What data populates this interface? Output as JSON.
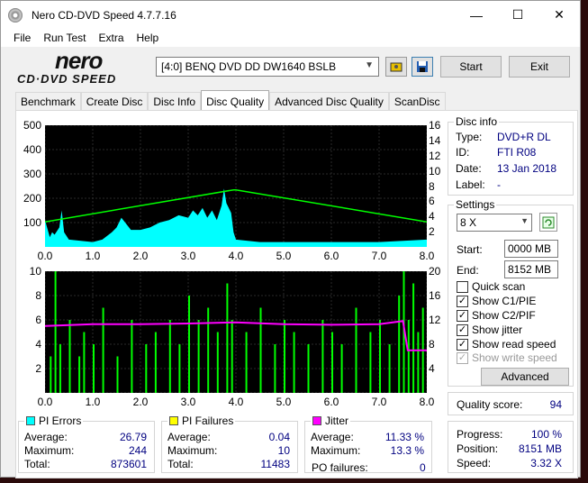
{
  "window": {
    "title": "Nero CD-DVD Speed 4.7.7.16",
    "min": "—",
    "max": "☐",
    "close": "✕"
  },
  "menu": [
    "File",
    "Run Test",
    "Extra",
    "Help"
  ],
  "logo": {
    "nero": "nero",
    "sub": "CD·DVD SPEED"
  },
  "drive": {
    "value": "[4:0]   BENQ DVD DD DW1640 BSLB"
  },
  "buttons": {
    "start": "Start",
    "exit": "Exit",
    "advanced": "Advanced"
  },
  "tabs": [
    "Benchmark",
    "Create Disc",
    "Disc Info",
    "Disc Quality",
    "Advanced Disc Quality",
    "ScanDisc"
  ],
  "disc_info": {
    "title": "Disc info",
    "type_l": "Type:",
    "type": "DVD+R DL",
    "id_l": "ID:",
    "id": "FTI R08",
    "date_l": "Date:",
    "date": "13 Jan 2018",
    "label_l": "Label:",
    "label": "-"
  },
  "settings": {
    "title": "Settings",
    "speed": "8 X",
    "start_l": "Start:",
    "start": "0000 MB",
    "end_l": "End:",
    "end": "8152 MB",
    "quick": "Quick scan",
    "c1": "Show C1/PIE",
    "c2": "Show C2/PIF",
    "jitter": "Show jitter",
    "read": "Show read speed",
    "write": "Show write speed"
  },
  "quality": {
    "label": "Quality score:",
    "value": "94"
  },
  "progress": {
    "p_l": "Progress:",
    "p": "100 %",
    "pos_l": "Position:",
    "pos": "8151 MB",
    "sp_l": "Speed:",
    "sp": "3.32 X"
  },
  "pi_errors": {
    "title": "PI Errors",
    "avg_l": "Average:",
    "avg": "26.79",
    "max_l": "Maximum:",
    "max": "244",
    "tot_l": "Total:",
    "tot": "873601"
  },
  "pi_failures": {
    "title": "PI Failures",
    "avg_l": "Average:",
    "avg": "0.04",
    "max_l": "Maximum:",
    "max": "10",
    "tot_l": "Total:",
    "tot": "11483"
  },
  "jitter": {
    "title": "Jitter",
    "avg_l": "Average:",
    "avg": "11.33 %",
    "max_l": "Maximum:",
    "max": "13.3 %",
    "po_l": "PO failures:",
    "po": "0"
  },
  "colors": {
    "pie": "#00ffff",
    "pif": "#ffff00",
    "jitter": "#ff00ff",
    "speed": "#00ff00",
    "bar": "#00ff00"
  },
  "chart_data": [
    {
      "type": "area",
      "title": "PI Errors / read speed",
      "x_ticks": [
        "0.0",
        "1.0",
        "2.0",
        "3.0",
        "4.0",
        "5.0",
        "6.0",
        "7.0",
        "8.0"
      ],
      "y_left_ticks": [
        "500",
        "400",
        "300",
        "200",
        "100"
      ],
      "y_right_ticks": [
        "16",
        "14",
        "12",
        "10",
        "8",
        "6",
        "4",
        "2"
      ],
      "ylim": [
        0,
        500
      ],
      "y2lim": [
        0,
        16
      ],
      "series": [
        {
          "name": "PI Errors",
          "x": [
            0,
            0.1,
            0.15,
            0.2,
            0.3,
            0.35,
            0.4,
            0.5,
            1.0,
            1.2,
            1.4,
            1.5,
            1.6,
            1.8,
            2.0,
            2.2,
            2.4,
            2.6,
            2.8,
            3.0,
            3.1,
            3.2,
            3.3,
            3.4,
            3.5,
            3.6,
            3.7,
            3.75,
            3.8,
            3.9,
            3.95,
            4.0,
            4.5,
            5.0,
            6.0,
            7.0,
            7.5,
            8.0
          ],
          "values": [
            110,
            40,
            60,
            50,
            80,
            150,
            60,
            30,
            20,
            30,
            60,
            80,
            120,
            70,
            70,
            80,
            100,
            110,
            130,
            120,
            150,
            130,
            160,
            120,
            150,
            110,
            170,
            240,
            180,
            140,
            60,
            30,
            20,
            20,
            20,
            20,
            25,
            30
          ]
        },
        {
          "name": "Read speed",
          "x": [
            0,
            3.95,
            4.0,
            8.0
          ],
          "values": [
            3.3,
            7.5,
            7.5,
            3.3
          ]
        }
      ]
    },
    {
      "type": "bar",
      "title": "PI Failures / jitter",
      "x_ticks": [
        "0.0",
        "1.0",
        "2.0",
        "3.0",
        "4.0",
        "5.0",
        "6.0",
        "7.0",
        "8.0"
      ],
      "y_left_ticks": [
        "10",
        "8",
        "6",
        "4",
        "2"
      ],
      "y_right_ticks": [
        "20",
        "16",
        "12",
        "8",
        "4"
      ],
      "ylim": [
        0,
        10
      ],
      "y2lim": [
        0,
        20
      ],
      "series": [
        {
          "name": "PI Failures",
          "x": [
            0.1,
            0.2,
            0.3,
            0.5,
            0.7,
            0.8,
            1.0,
            1.2,
            1.5,
            1.8,
            2.1,
            2.3,
            2.6,
            2.8,
            3.0,
            3.2,
            3.4,
            3.6,
            3.8,
            3.9,
            4.2,
            4.5,
            4.8,
            5.0,
            5.2,
            5.5,
            5.8,
            6.0,
            6.2,
            6.5,
            6.8,
            7.0,
            7.2,
            7.4,
            7.5,
            7.6,
            7.7,
            7.8,
            7.9
          ],
          "values": [
            3,
            10,
            4,
            6,
            3,
            5,
            4,
            7,
            3,
            6,
            4,
            5,
            6,
            4,
            8,
            6,
            7,
            5,
            9,
            6,
            5,
            7,
            4,
            6,
            5,
            4,
            6,
            5,
            4,
            7,
            5,
            6,
            4,
            8,
            10,
            6,
            9,
            5,
            7
          ]
        },
        {
          "name": "Jitter",
          "x": [
            0,
            1,
            2,
            3,
            4,
            5,
            6,
            7,
            7.5,
            7.6,
            8.0
          ],
          "values": [
            11,
            11.3,
            11.3,
            11.4,
            11.6,
            11.3,
            11.2,
            11.3,
            11.8,
            7,
            7
          ]
        }
      ]
    }
  ]
}
